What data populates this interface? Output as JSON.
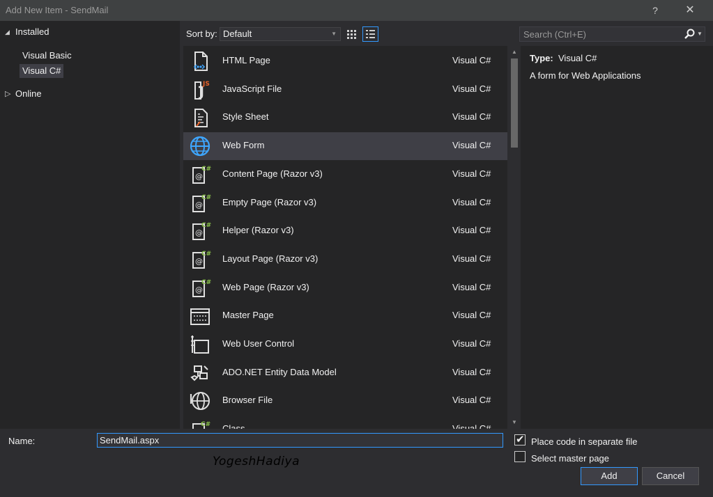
{
  "window": {
    "title": "Add New Item - SendMail",
    "help_glyph": "?",
    "close_glyph": "✕"
  },
  "tree": {
    "installed": "Installed",
    "visual_basic": "Visual Basic",
    "visual_csharp": "Visual C#",
    "online": "Online"
  },
  "toolbar": {
    "sort_label": "Sort by:",
    "sort_value": "Default"
  },
  "search": {
    "placeholder": "Search (Ctrl+E)"
  },
  "items": [
    {
      "name": "HTML Page",
      "lang": "Visual C#",
      "icon": "html-page-icon"
    },
    {
      "name": "JavaScript File",
      "lang": "Visual C#",
      "icon": "javascript-file-icon"
    },
    {
      "name": "Style Sheet",
      "lang": "Visual C#",
      "icon": "style-sheet-icon"
    },
    {
      "name": "Web Form",
      "lang": "Visual C#",
      "icon": "globe-icon"
    },
    {
      "name": "Content Page (Razor v3)",
      "lang": "Visual C#",
      "icon": "razor-page-icon"
    },
    {
      "name": "Empty Page (Razor v3)",
      "lang": "Visual C#",
      "icon": "razor-page-icon"
    },
    {
      "name": "Helper (Razor v3)",
      "lang": "Visual C#",
      "icon": "razor-page-icon"
    },
    {
      "name": "Layout Page (Razor v3)",
      "lang": "Visual C#",
      "icon": "razor-page-icon"
    },
    {
      "name": "Web Page (Razor v3)",
      "lang": "Visual C#",
      "icon": "razor-page-icon"
    },
    {
      "name": "Master Page",
      "lang": "Visual C#",
      "icon": "master-page-icon"
    },
    {
      "name": "Web User Control",
      "lang": "Visual C#",
      "icon": "user-control-icon"
    },
    {
      "name": "ADO.NET Entity Data Model",
      "lang": "Visual C#",
      "icon": "entity-model-icon"
    },
    {
      "name": "Browser File",
      "lang": "Visual C#",
      "icon": "browser-file-icon"
    },
    {
      "name": "Class",
      "lang": "Visual C#",
      "icon": "class-icon"
    }
  ],
  "selected_item_index": 3,
  "details": {
    "type_label": "Type:",
    "type_value": "Visual C#",
    "description": "A form for Web Applications"
  },
  "form": {
    "name_label": "Name:",
    "name_value": "SendMail.aspx",
    "place_code_label": "Place code in separate file",
    "place_code_checked": true,
    "master_page_label": "Select master page",
    "master_page_checked": false,
    "add_label": "Add",
    "cancel_label": "Cancel"
  },
  "watermark": "YogeshHadiya",
  "colors": {
    "accent": "#3399ff",
    "background": "#2d2d30",
    "pane": "#252526",
    "selection": "#3f3f46",
    "razor_green": "#8bc34a",
    "js_orange": "#e8622a"
  }
}
